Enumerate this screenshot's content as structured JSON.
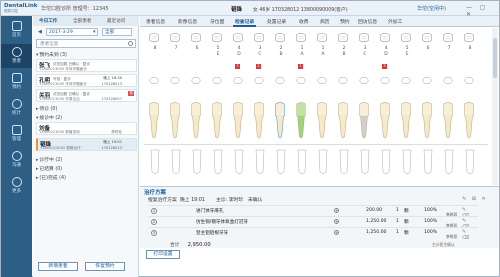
{
  "app": {
    "logo_line1": "DentalLink",
    "logo_line2": "德泰口腔",
    "clinic_text": "华佗口腔诊所  管理号：12345",
    "user_status": "华佗(空闲中)",
    "window_buttons": "— ▢ ✕"
  },
  "nav": [
    {
      "label": "首页",
      "icon": "home-icon"
    },
    {
      "label": "患者",
      "icon": "patient-icon"
    },
    {
      "label": "预约",
      "icon": "calendar-icon"
    },
    {
      "label": "统计",
      "icon": "stats-icon"
    },
    {
      "label": "管理",
      "icon": "manage-icon"
    },
    {
      "label": "沟通",
      "icon": "chat-icon"
    },
    {
      "label": "更多",
      "icon": "more-icon"
    }
  ],
  "panel": {
    "tabs": [
      "今日工作",
      "全部患者",
      "最近访问"
    ],
    "date": "2017-3-29",
    "filter": "全部",
    "search_placeholder": "患者信息",
    "groups": [
      {
        "label": "预约未到 (3)"
      },
      {
        "label": "待诊 (0)"
      },
      {
        "label": "接诊中 (2)"
      },
      {
        "label": "诊疗中 (2)"
      },
      {
        "label": "已结算 (0)"
      },
      {
        "label": "(已)完成 (4)"
      }
    ],
    "patients": [
      {
        "name": "张飞",
        "tags": "试充加数 已确认 · 复诊",
        "line2": "13800013000  牙体牙髓面诊",
        "time": "",
        "doctor": "",
        "status": "",
        "color": "#e8953a"
      },
      {
        "name": "孔明",
        "tags": "牙冠 · 复诊",
        "line2": "13800013000  牙体牙髓面诊",
        "time": "晚上 18:30",
        "doctor": "170328013",
        "status": "",
        "color": "#3d8fd1"
      },
      {
        "name": "关羽",
        "tags": "试充加数 已确认 · 复诊",
        "line2": "13800013000  牙周洁治",
        "time": "",
        "doctor": "170328007",
        "status": "待",
        "color": "#3d8fd1"
      },
      {
        "name": "刘备",
        "tags": "",
        "line2": "13800013000  种植咨询",
        "time": "",
        "doctor": "李时珍",
        "status": "",
        "color": "#e8953a"
      },
      {
        "name": "韬锋",
        "tags": "",
        "line2": "13800013000  根管治疗",
        "time": "晚上 19:01",
        "doctor": "170328013",
        "status": "",
        "color": "#3d8fd1"
      }
    ],
    "new_patient_label": "新增患者",
    "restore_label": "恢复预约"
  },
  "patient_bar": {
    "name": "韬锋",
    "info": "女  46岁  170328012  13800090009(客户)"
  },
  "tabs": [
    "患者信息",
    "影像信息",
    "牙位图",
    "检查记录",
    "处置记录",
    "收费",
    "病历",
    "预约",
    "回访信息",
    "外加工"
  ],
  "active_tab": "检查记录",
  "teeth_upper_numbers": [
    "8",
    "7",
    "6",
    "5",
    "4",
    "3",
    "2",
    "1",
    "1",
    "2",
    "3",
    "4",
    "5",
    "6",
    "7",
    "8"
  ],
  "teeth_upper_labels": [
    "",
    "",
    "",
    "E",
    "D",
    "C",
    "B",
    "A",
    "A",
    "B",
    "C",
    "D",
    "E",
    "",
    "",
    ""
  ],
  "red_markers": [
    {
      "tooth": 4,
      "label": "3"
    },
    {
      "tooth": 5,
      "label": "2"
    },
    {
      "tooth": 7,
      "label": "1"
    },
    {
      "tooth": 11,
      "label": "3"
    }
  ],
  "treatment": {
    "title": "治疗方案",
    "plan_name": "橙复治疗方案",
    "plan_time": "晚上 19:01",
    "doctor_label": "主诊: 李时珍",
    "status_label": "未确认",
    "items": [
      {
        "no": "1",
        "desc": "进门体牙麻孔",
        "price": "200.00",
        "qty": "1",
        "unit": "颗",
        "total": "100%",
        "doctor": "李时珍"
      },
      {
        "no": "2",
        "desc": "仿生铜/钢牙体氧金灯冠牙",
        "price": "1,250.00",
        "qty": "1",
        "unit": "颗",
        "total": "100%",
        "doctor": "李时珍"
      },
      {
        "no": "3",
        "desc": "登主铝铝根牙牙",
        "price": "1,250.00",
        "qty": "1",
        "unit": "颗",
        "total": "100%",
        "doctor": "李时珍"
      }
    ],
    "total_label": "合计",
    "total_value": "2,950.00",
    "footer_note": "主诊医生确认",
    "print_label": "打印设置"
  }
}
